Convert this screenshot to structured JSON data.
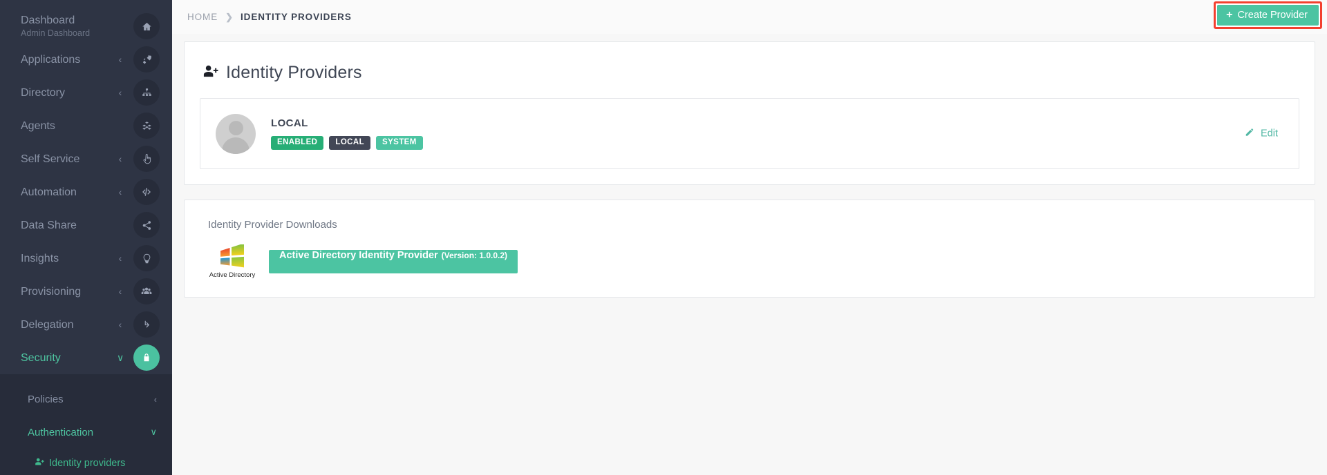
{
  "sidebar": {
    "items": [
      {
        "label": "Dashboard",
        "sublabel": "Admin Dashboard",
        "icon": "home-icon",
        "caret": "",
        "active": false
      },
      {
        "label": "Applications",
        "sublabel": "",
        "icon": "rocket-icon",
        "caret": "‹",
        "active": false
      },
      {
        "label": "Directory",
        "sublabel": "",
        "icon": "sitemap-icon",
        "caret": "‹",
        "active": false
      },
      {
        "label": "Agents",
        "sublabel": "",
        "icon": "cubes-icon",
        "caret": "",
        "active": false
      },
      {
        "label": "Self Service",
        "sublabel": "",
        "icon": "hand-pointer-icon",
        "caret": "‹",
        "active": false
      },
      {
        "label": "Automation",
        "sublabel": "",
        "icon": "code-icon",
        "caret": "‹",
        "active": false
      },
      {
        "label": "Data Share",
        "sublabel": "",
        "icon": "share-icon",
        "caret": "",
        "active": false
      },
      {
        "label": "Insights",
        "sublabel": "",
        "icon": "lightbulb-icon",
        "caret": "‹",
        "active": false
      },
      {
        "label": "Provisioning",
        "sublabel": "",
        "icon": "users-icon",
        "caret": "‹",
        "active": false
      },
      {
        "label": "Delegation",
        "sublabel": "",
        "icon": "level-down-icon",
        "caret": "‹",
        "active": false
      },
      {
        "label": "Security",
        "sublabel": "",
        "icon": "lock-icon",
        "caret": "∨",
        "active": true
      }
    ],
    "submenu": [
      {
        "label": "Policies",
        "caret": "‹",
        "active": false
      },
      {
        "label": "Authentication",
        "caret": "∨",
        "active": true
      }
    ],
    "level3": [
      {
        "label": "Identity providers",
        "icon": "user-plus-icon",
        "active": true
      }
    ],
    "colors": {
      "background": "#2e3444",
      "submenu_background": "#272c3a",
      "accent": "#4ec4a0",
      "muted_text": "#8a93a6"
    }
  },
  "topbar": {
    "breadcrumb": {
      "home": "HOME",
      "separator": "❯",
      "current": "IDENTITY PROVIDERS"
    },
    "create_button": {
      "label": "Create Provider",
      "plus": "+",
      "highlight_color": "#f3402f",
      "color": "#4cc4a2"
    }
  },
  "page": {
    "title": "Identity Providers",
    "title_icon": "user-plus-icon"
  },
  "provider": {
    "name": "LOCAL",
    "avatar": "user-avatar-placeholder",
    "badges": [
      {
        "label": "ENABLED",
        "color": "#27ae76"
      },
      {
        "label": "LOCAL",
        "color": "#424756"
      },
      {
        "label": "SYSTEM",
        "color": "#4cc4a2"
      }
    ],
    "edit": {
      "label": "Edit",
      "icon": "pencil-icon",
      "color": "#53b8a5"
    }
  },
  "downloads": {
    "title": "Identity Provider Downloads",
    "items": [
      {
        "logo_caption": "Active Directory",
        "logo_icon": "windows-logo-icon",
        "name": "Active Directory Identity Provider",
        "version": "(Version: 1.0.0.2)"
      }
    ]
  }
}
